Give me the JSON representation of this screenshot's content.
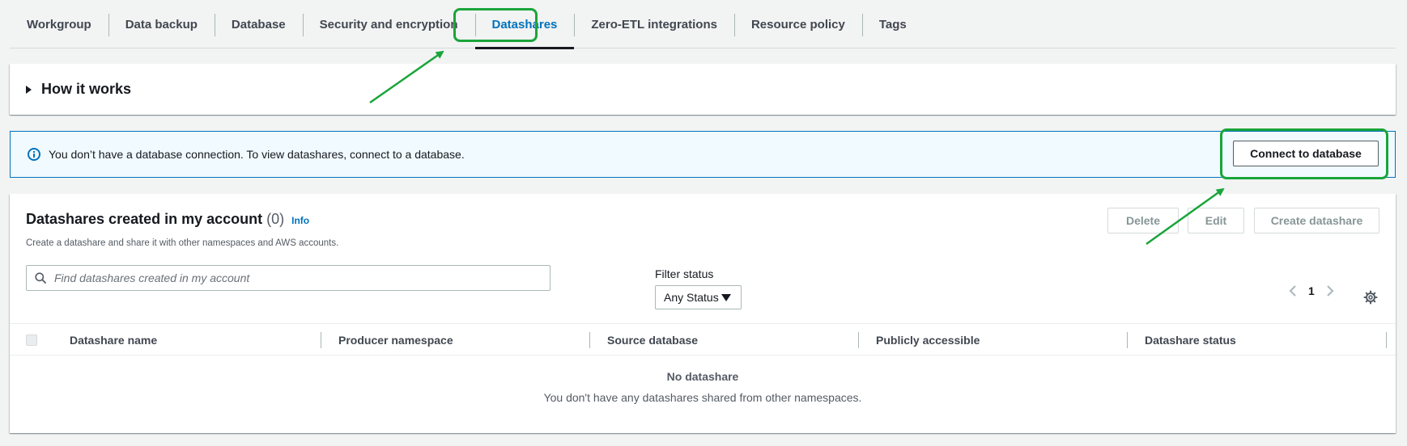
{
  "tabs": [
    {
      "label": "Workgroup"
    },
    {
      "label": "Data backup"
    },
    {
      "label": "Database"
    },
    {
      "label": "Security and encryption"
    },
    {
      "label": "Datashares",
      "active": true
    },
    {
      "label": "Zero-ETL integrations"
    },
    {
      "label": "Resource policy"
    },
    {
      "label": "Tags"
    }
  ],
  "how_it_works": {
    "title": "How it works",
    "icon": "caret-right-icon"
  },
  "alert": {
    "icon": "info-icon",
    "text": "You don’t have a database connection. To view datashares, connect to a database.",
    "button": "Connect to database"
  },
  "datashares": {
    "title": "Datashares created in my account",
    "count": "(0)",
    "info_link": "Info",
    "description": "Create a datashare and share it with other namespaces and AWS accounts.",
    "actions": {
      "delete": "Delete",
      "edit": "Edit",
      "create": "Create datashare"
    },
    "search": {
      "placeholder": "Find datashares created in my account"
    },
    "filter": {
      "label": "Filter status",
      "value": "Any Status"
    },
    "pagination": {
      "current_page": "1"
    },
    "columns": [
      "Datashare name",
      "Producer namespace",
      "Source database",
      "Publicly accessible",
      "Datashare status"
    ],
    "empty": {
      "title": "No datashare",
      "description": "You don't have any datashares shared from other namespaces."
    }
  },
  "annotations": {
    "color": "#1aa53a"
  }
}
